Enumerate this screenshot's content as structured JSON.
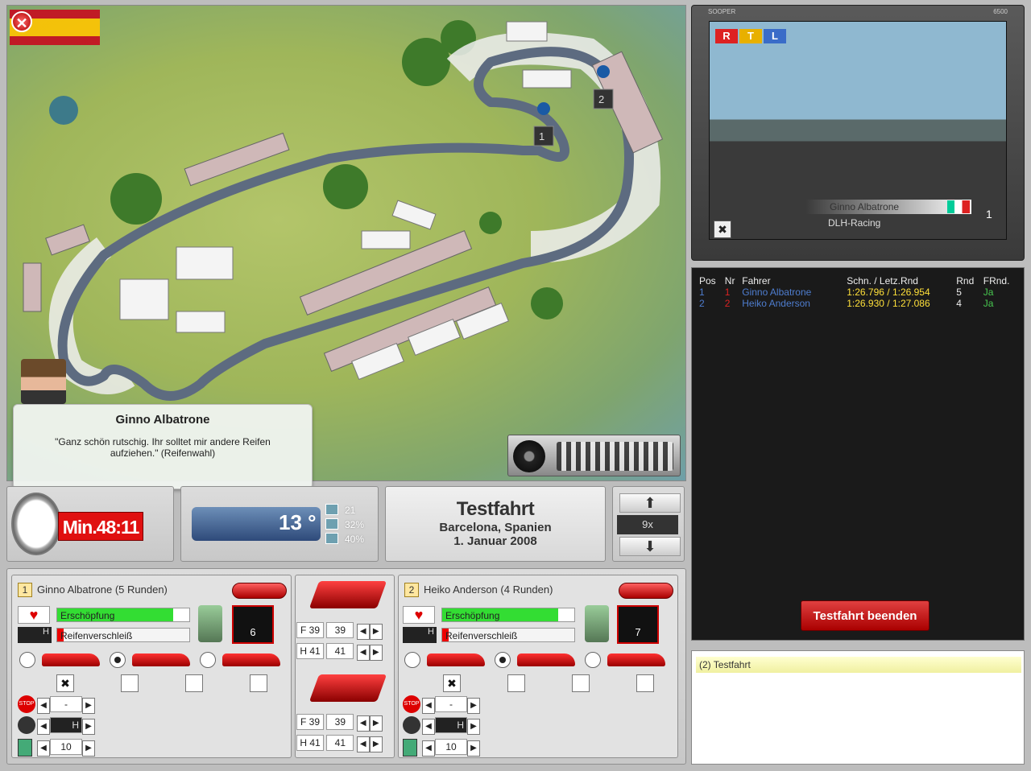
{
  "map": {
    "driver_name": "Ginno Albatrone",
    "quote": "\"Ganz schön rutschig. Ihr solltet mir andere Reifen aufziehen.\" (Reifenwahl)",
    "marker_1": "1",
    "marker_2": "2",
    "close_icon": "close-icon"
  },
  "status": {
    "timer": "Min.48:11",
    "temperature": "13 °",
    "stat1": "21",
    "stat2": "32%",
    "stat3": "40%"
  },
  "session": {
    "title": "Testfahrt",
    "location": "Barcelona, Spanien",
    "date": "1. Januar 2008"
  },
  "speed": {
    "value": "9x",
    "up_icon": "arrow-up-icon",
    "down_icon": "arrow-down-icon"
  },
  "tv": {
    "brand_left": "SOOPER",
    "brand_right": "6500",
    "logo": [
      "R",
      "T",
      "L"
    ],
    "driver": "Ginno Albatrone",
    "team": "DLH-Racing",
    "position": "1",
    "close_label": "✖"
  },
  "standings": {
    "headers": [
      "Pos",
      "Nr",
      "Fahrer",
      "Schn. / Letz.Rnd",
      "Rnd",
      "FRnd."
    ],
    "rows": [
      {
        "pos": "1",
        "nr": "1",
        "driver": "Ginno Albatrone",
        "times": "1:26.796 / 1:26.954",
        "rnd": "5",
        "frnd": "Ja"
      },
      {
        "pos": "2",
        "nr": "2",
        "driver": "Heiko Anderson",
        "times": "1:26.930 / 1:27.086",
        "rnd": "4",
        "frnd": "Ja"
      }
    ],
    "end_button": "Testfahrt beenden"
  },
  "log": {
    "entry": "(2) Testfahrt"
  },
  "drivers": [
    {
      "num": "1",
      "name": "Ginno Albatrone (5 Runden)",
      "exhaustion": "Erschöpfung",
      "exhaustion_pct": 0.88,
      "wear": "Reifenverschleiß",
      "fuel_display": "6",
      "stepper_value": "-",
      "tire_value": "H",
      "fuel_value": "10",
      "x_mark": "✖"
    },
    {
      "num": "2",
      "name": "Heiko Anderson (4 Runden)",
      "exhaustion": "Erschöpfung",
      "exhaustion_pct": 0.88,
      "wear": "Reifenverschleiß",
      "fuel_display": "7",
      "stepper_value": "-",
      "tire_value": "H",
      "fuel_value": "10",
      "x_mark": "✖"
    }
  ],
  "setup": [
    {
      "f_label": "F 39",
      "f_val": "39",
      "h_label": "H 41",
      "h_val": "41"
    },
    {
      "f_label": "F 39",
      "f_val": "39",
      "h_label": "H 41",
      "h_val": "41"
    }
  ],
  "colors": {
    "accent_red": "#e01010",
    "bar_green": "#33dd33",
    "panel": "#d0d0d0"
  }
}
